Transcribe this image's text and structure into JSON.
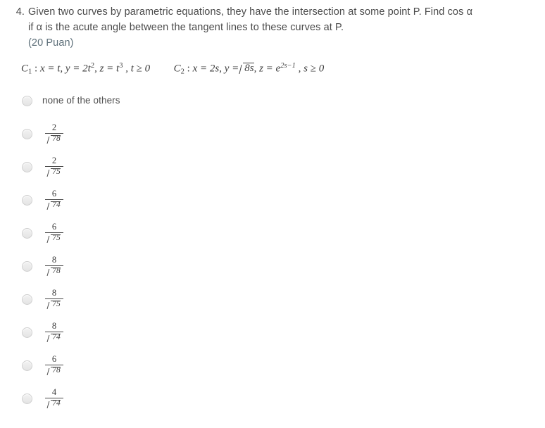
{
  "question": {
    "number": "4.",
    "line1": "Given two curves by parametric equations, they have the intersection at some point P. Find cos α",
    "line2": "if  α is the acute angle between the tangent lines to these curves at P.",
    "points": "(20 Puan)",
    "points_color": "#5d6f79",
    "text_color": "#4a4a4a"
  },
  "equations": {
    "curve1": {
      "name": "C",
      "subscript": "1",
      "colon": ":",
      "x": "x = t,",
      "y_base": "y = 2t",
      "y_exp": "2",
      "y_tail": ",",
      "z_base": "z = t",
      "z_exp": "3",
      "domain": ", t ≥ 0"
    },
    "curve2": {
      "name": "C",
      "subscript": "2",
      "colon": ":",
      "x": "x = 2s,",
      "y_prefix": "y =",
      "y_radicand": "8s",
      "y_tail": ",",
      "z_base": "z = e",
      "z_exp": "2s−1",
      "domain": ", s ≥ 0"
    }
  },
  "options": [
    {
      "type": "text",
      "label": "none of the others"
    },
    {
      "type": "fraction",
      "numerator": "2",
      "denominator": "78",
      "label": "2 over square root of 78"
    },
    {
      "type": "fraction",
      "numerator": "2",
      "denominator": "75",
      "label": "2 over square root of 75"
    },
    {
      "type": "fraction",
      "numerator": "6",
      "denominator": "74",
      "label": "6 over square root of 74"
    },
    {
      "type": "fraction",
      "numerator": "6",
      "denominator": "75",
      "label": "6 over square root of 75"
    },
    {
      "type": "fraction",
      "numerator": "8",
      "denominator": "78",
      "label": "8 over square root of 78"
    },
    {
      "type": "fraction",
      "numerator": "8",
      "denominator": "75",
      "label": "8 over square root of 75"
    },
    {
      "type": "fraction",
      "numerator": "8",
      "denominator": "74",
      "label": "8 over square root of 74"
    },
    {
      "type": "fraction",
      "numerator": "6",
      "denominator": "78",
      "label": "6 over square root of 78"
    },
    {
      "type": "fraction",
      "numerator": "4",
      "denominator": "74",
      "label": "4 over square root of 74"
    }
  ]
}
